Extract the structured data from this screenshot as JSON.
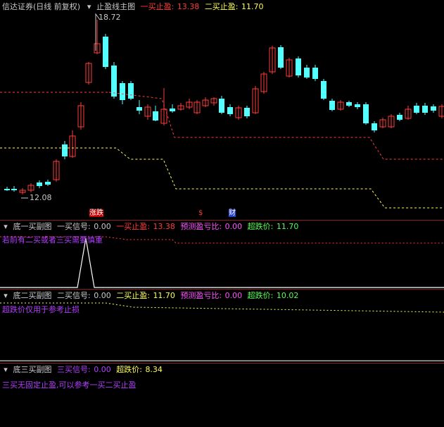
{
  "main": {
    "title": "信达证券(日线 前复权)",
    "indicator": "止盈线主图",
    "tp1_label": "一买止盈:",
    "tp1_value": "13.38",
    "tp2_label": "二买止盈:",
    "tp2_value": "11.70",
    "high_label": "18.72",
    "low_label": "12.08",
    "markers": [
      "涨跌",
      "$",
      "财"
    ]
  },
  "sub1": {
    "title": "底一买副图",
    "sig_label": "一买信号:",
    "sig_value": "0.00",
    "tp_label": "一买止盈:",
    "tp_value": "13.38",
    "pl_label": "预测盈亏比:",
    "pl_value": "0.00",
    "ov_label": "超跌价:",
    "ov_value": "11.70",
    "note": "若前有二买或者三买需要慎重"
  },
  "sub2": {
    "title": "底二买副图",
    "sig_label": "二买信号:",
    "sig_value": "0.00",
    "tp_label": "二买止盈:",
    "tp_value": "11.70",
    "pl_label": "预测盈亏比:",
    "pl_value": "0.00",
    "ov_label": "超跌价:",
    "ov_value": "10.02",
    "note": "超跌价仅用于参考止损"
  },
  "sub3": {
    "title": "底三买副图",
    "sig_label": "三买信号:",
    "sig_value": "0.00",
    "ov_label": "超跌价:",
    "ov_value": "8.34",
    "note": "三买无固定止盈,可以参考一买二买止盈"
  },
  "colors": {
    "up": "#ff3c3c",
    "down": "#54ffff",
    "tp1": "#ff3c3c",
    "tp2": "#ffff54",
    "note": "#b23cff"
  }
}
